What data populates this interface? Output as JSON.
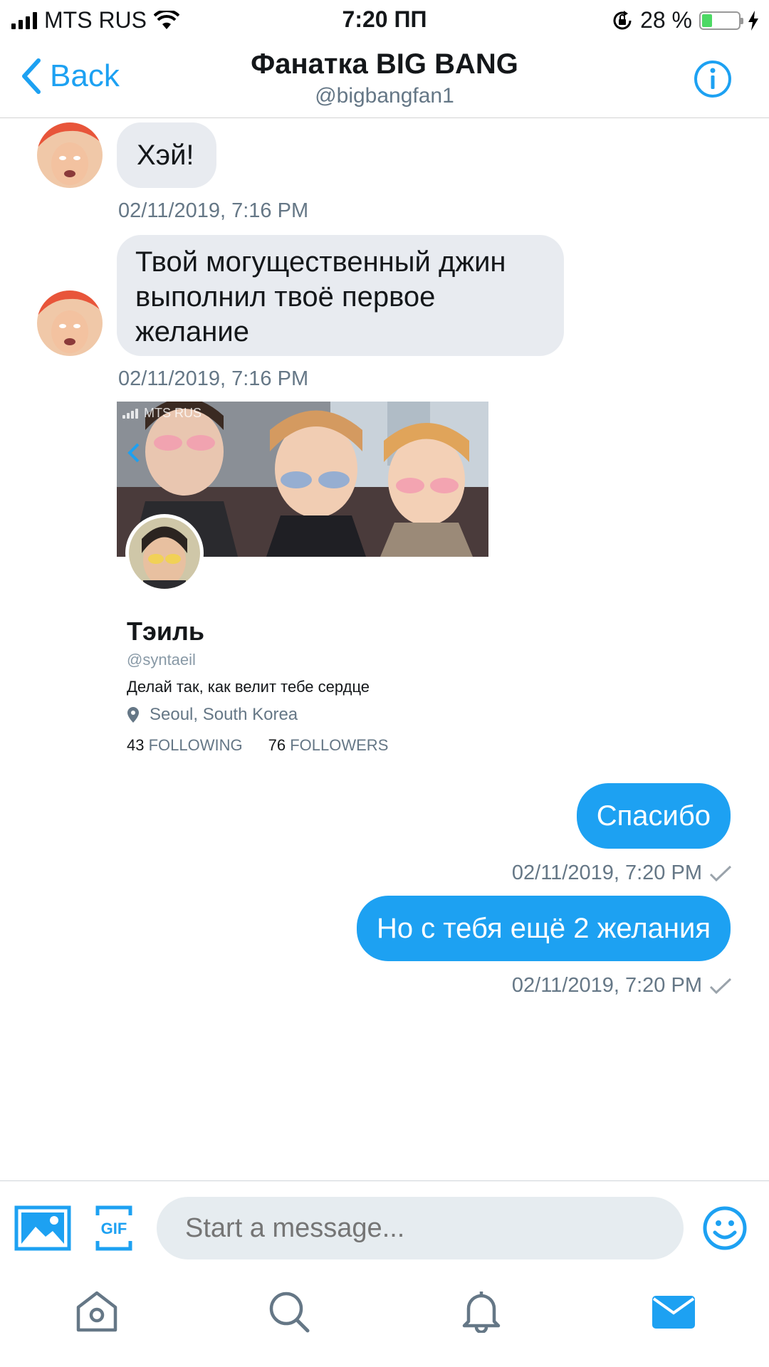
{
  "status_bar": {
    "carrier": "MTS RUS",
    "time": "7:20 ПП",
    "battery_text": "28 %",
    "battery_level": 0.28,
    "battery_color": "#4cd964"
  },
  "header": {
    "back_label": "Back",
    "title": "Фанатка BIG BANG",
    "handle": "@bigbangfan1",
    "info_icon": "info-icon"
  },
  "colors": {
    "accent": "#1da1f2",
    "incoming_bubble": "#e8ebf0",
    "outgoing_bubble": "#1da1f2"
  },
  "messages": [
    {
      "direction": "in",
      "text": "Хэй!",
      "timestamp": "02/11/2019, 7:16 PM"
    },
    {
      "direction": "in",
      "text": "Твой могущественный джин выполнил твоё первое желание",
      "timestamp": "02/11/2019, 7:16 PM"
    },
    {
      "direction": "out",
      "text": "Спасибо",
      "timestamp": "02/11/2019, 7:20 PM",
      "status_icon": "check-icon"
    },
    {
      "direction": "out",
      "text": "Но с тебя ещё 2 желания",
      "timestamp": "02/11/2019, 7:20 PM",
      "status_icon": "check-icon"
    }
  ],
  "profile_card": {
    "banner_status_carrier": "MTS RUS",
    "name": "Тэиль",
    "handle": "@syntaeil",
    "bio": "Делай так, как велит тебе сердце",
    "location": "Seoul, South Korea",
    "following_count": "43",
    "following_label": "FOLLOWING",
    "followers_count": "76",
    "followers_label": "FOLLOWERS"
  },
  "composer": {
    "placeholder": "Start a message...",
    "icons": [
      "image-icon",
      "gif-icon",
      "emoji-icon"
    ]
  },
  "tabbar": {
    "tabs": [
      "home-icon",
      "search-icon",
      "notifications-icon",
      "messages-icon"
    ],
    "active": "messages-icon"
  }
}
